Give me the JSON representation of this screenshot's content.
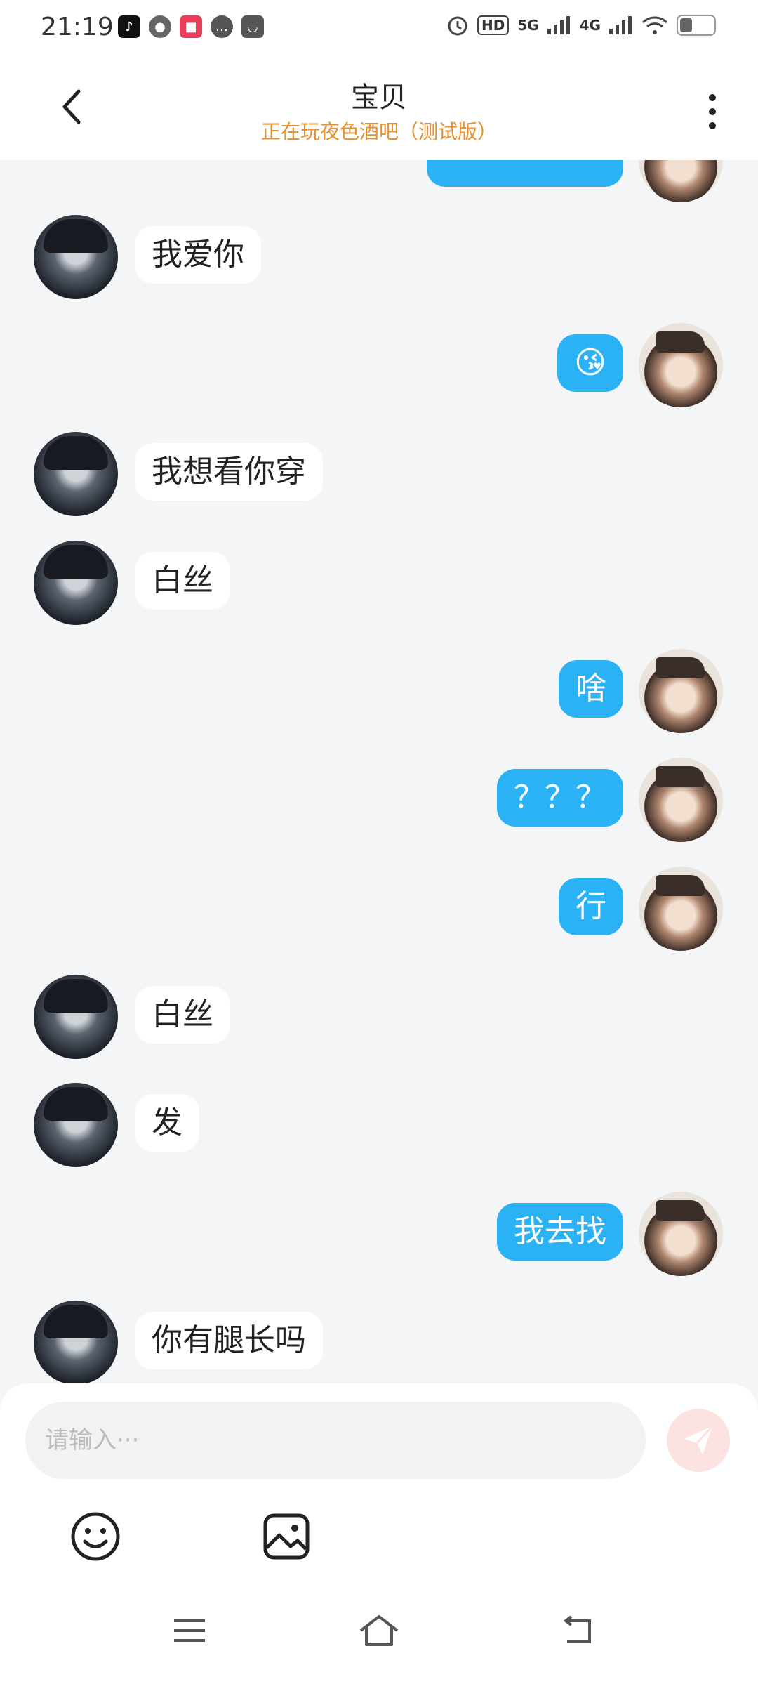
{
  "status_bar": {
    "time": "21:19",
    "apps": [
      "tiktok-icon",
      "wechat-icon",
      "app-icon",
      "message-icon",
      "bag-icon"
    ],
    "network": "5G",
    "network2": "4G",
    "hd": "HD"
  },
  "header": {
    "title": "宝贝",
    "subtitle": "正在玩夜色酒吧（测试版）"
  },
  "messages": [
    {
      "side": "left",
      "text": "我爱你"
    },
    {
      "side": "right",
      "text": "😘"
    },
    {
      "side": "left",
      "text": "我想看你穿"
    },
    {
      "side": "left",
      "text": "白丝"
    },
    {
      "side": "right",
      "text": "啥"
    },
    {
      "side": "right",
      "text": "？？？"
    },
    {
      "side": "right",
      "text": "行"
    },
    {
      "side": "left",
      "text": "白丝"
    },
    {
      "side": "left",
      "text": "发"
    },
    {
      "side": "right",
      "text": "我去找"
    },
    {
      "side": "left",
      "text": "你有腿长吗"
    }
  ],
  "input": {
    "placeholder": "请输入···"
  },
  "colors": {
    "bubble_right": "#2bb2f5",
    "subtitle": "#e8902a"
  }
}
